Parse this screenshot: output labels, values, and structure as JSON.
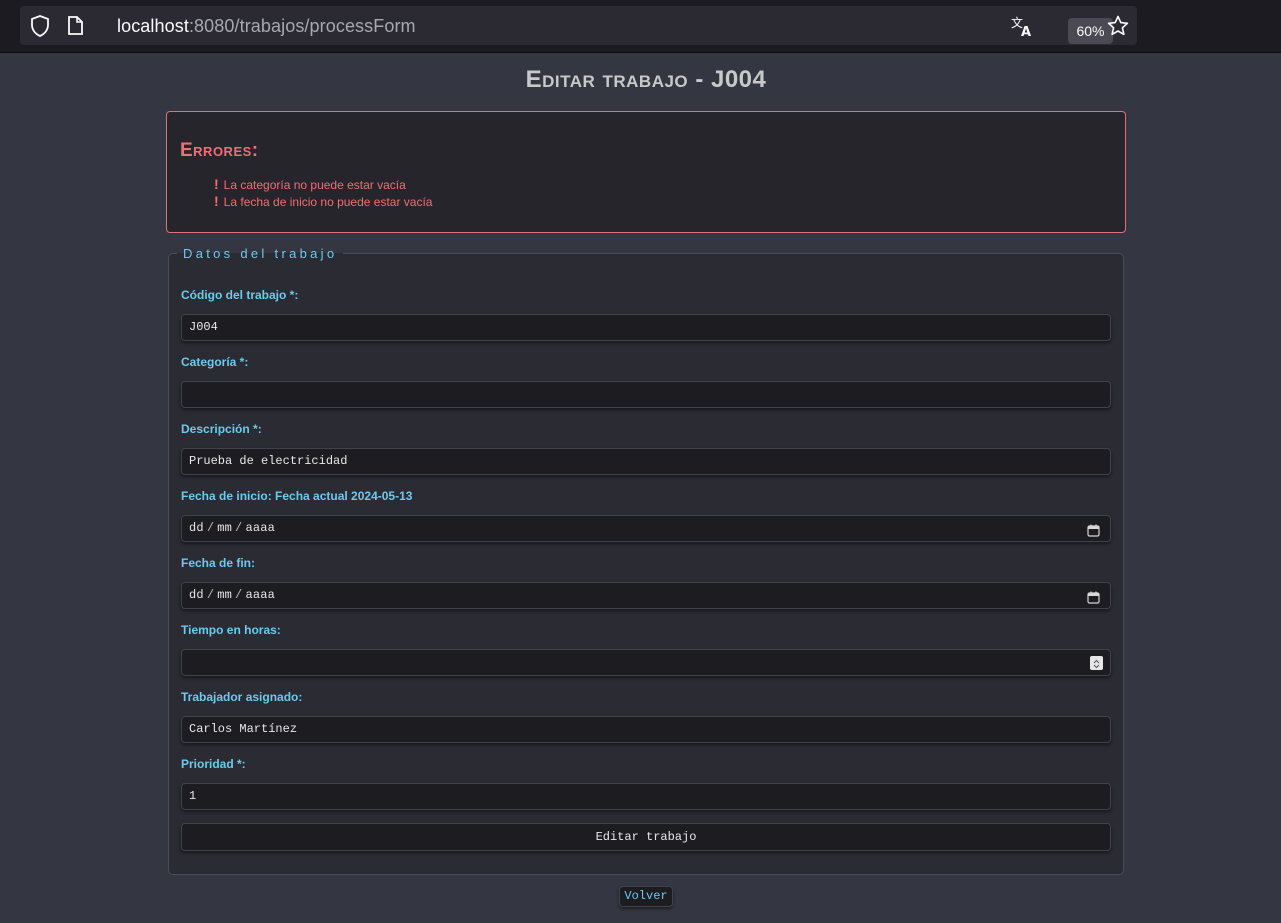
{
  "browser": {
    "url_host": "localhost",
    "url_rest": ":8080/trabajos/processForm",
    "zoom": "60%",
    "icons": [
      "shield-icon",
      "page-icon",
      "translate-icon",
      "star-icon"
    ]
  },
  "page": {
    "title": "Editar trabajo - J004"
  },
  "errors": {
    "title": "Errores:",
    "items": [
      "La categoría no puede estar vacía",
      "La fecha de inicio no puede estar vacía"
    ],
    "bullet": "!"
  },
  "form": {
    "legend": "Datos del trabajo",
    "codigo": {
      "label": "Código del trabajo *:",
      "value": "J004"
    },
    "categoria": {
      "label": "Categoría *:",
      "value": ""
    },
    "descripcion": {
      "label": "Descripción *:",
      "value": "Prueba de electricidad"
    },
    "fecha_inicio": {
      "label": "Fecha de inicio: Fecha actual 2024-05-13",
      "dd": "dd",
      "mm": "mm",
      "aaaa": "aaaa",
      "sep": "/"
    },
    "fecha_fin": {
      "label": "Fecha de fin:",
      "dd": "dd",
      "mm": "mm",
      "aaaa": "aaaa",
      "sep": "/"
    },
    "tiempo": {
      "label": "Tiempo en horas:",
      "value": ""
    },
    "trabajador": {
      "label": "Trabajador asignado:",
      "value": "Carlos Martínez"
    },
    "prioridad": {
      "label": "Prioridad *:",
      "value": "1"
    },
    "submit_label": "Editar trabajo"
  },
  "back_label": "Volver",
  "colors": {
    "accent": "#6bcbef",
    "error": "#f06e74",
    "background": "#343642"
  }
}
